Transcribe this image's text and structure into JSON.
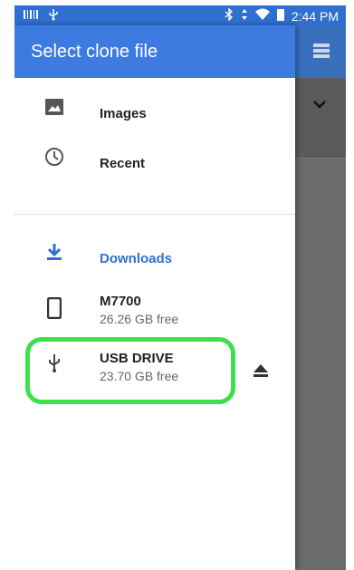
{
  "status_bar": {
    "time": "2:44 PM"
  },
  "drawer": {
    "title": "Select clone file",
    "items": [
      {
        "label": "Images",
        "icon": "image-icon"
      },
      {
        "label": "Recent",
        "icon": "clock-icon"
      },
      {
        "label": "Downloads",
        "icon": "download-icon",
        "accent": "#2f6fcf"
      },
      {
        "label": "M7700",
        "sub": "26.26 GB free",
        "icon": "phone-icon"
      },
      {
        "label": "USB DRIVE",
        "sub": "23.70 GB free",
        "icon": "usb-icon",
        "action_icon": "eject-icon"
      }
    ]
  },
  "colors": {
    "appbar": "#3d7be0",
    "status_bar": "#2f6fcf",
    "highlight": "#3ee04a",
    "accent": "#2f6fcf"
  }
}
